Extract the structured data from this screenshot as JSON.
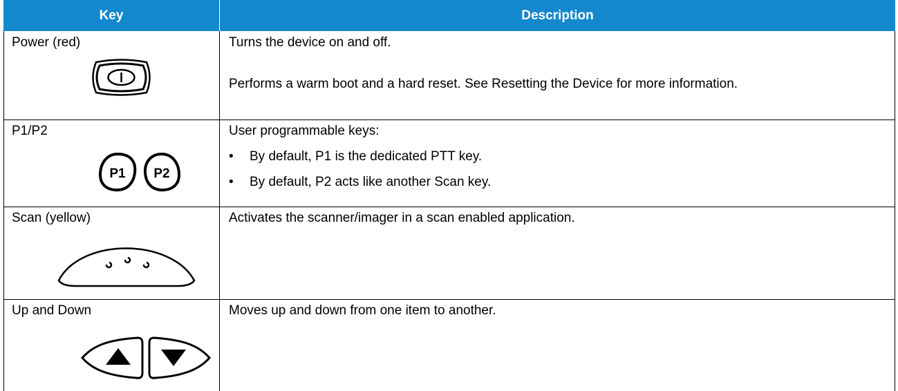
{
  "header": {
    "key": "Key",
    "description": "Description"
  },
  "rows": [
    {
      "key": "Power (red)",
      "icon": "power-button-icon",
      "description": [
        "Turns the device on and off.",
        "Performs a warm boot and a hard reset. See Resetting the Device for more information."
      ]
    },
    {
      "key": "P1/P2",
      "icons": [
        "p1-key-icon",
        "p2-key-icon"
      ],
      "icon_labels": [
        "P1",
        "P2"
      ],
      "description": "User programmable keys:",
      "bullets": [
        "By default, P1 is the dedicated PTT key.",
        "By default, P2 acts like another Scan key."
      ]
    },
    {
      "key": "Scan (yellow)",
      "icon": "scan-key-icon",
      "description": "Activates the scanner/imager in a scan enabled application."
    },
    {
      "key": "Up and Down",
      "icons": [
        "up-arrow-key-icon",
        "down-arrow-key-icon"
      ],
      "description": "Moves up and down from one item to another."
    }
  ]
}
